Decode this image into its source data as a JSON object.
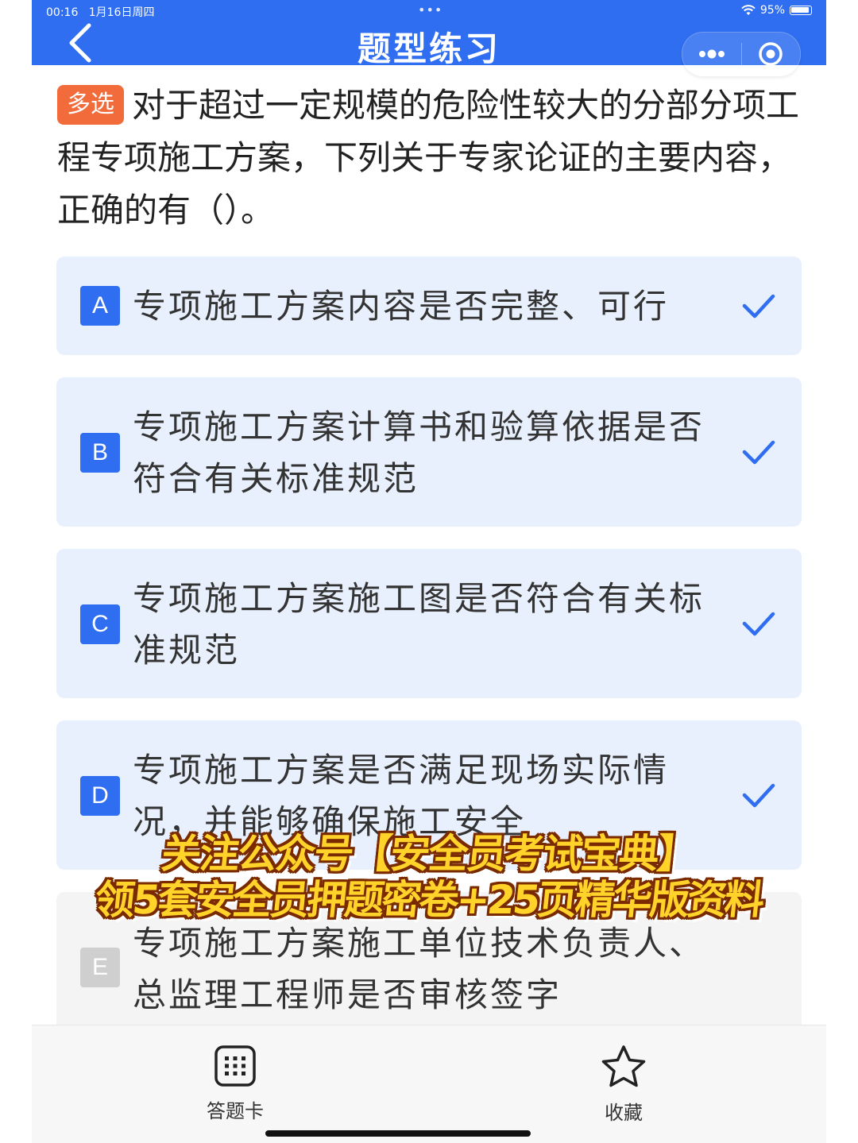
{
  "status": {
    "time": "00:16",
    "date": "1月16日周四",
    "battery": "95%",
    "dots": "•••"
  },
  "header": {
    "title": "题型练习"
  },
  "question": {
    "type_tag": "多选",
    "text": "对于超过一定规模的危险性较大的分部分项工程专项施工方案，下列关于专家论证的主要内容，正确的有（）。"
  },
  "options": [
    {
      "letter": "A",
      "text": "专项施工方案内容是否完整、可行",
      "selected": true
    },
    {
      "letter": "B",
      "text": "专项施工方案计算书和验算依据是否符合有关标准规范",
      "selected": true
    },
    {
      "letter": "C",
      "text": "专项施工方案施工图是否符合有关标准规范",
      "selected": true
    },
    {
      "letter": "D",
      "text": "专项施工方案是否满足现场实际情况，并能够确保施工安全",
      "selected": true
    },
    {
      "letter": "E",
      "text": "专项施工方案施工单位技术负责人、总监理工程师是否审核签字",
      "selected": false
    }
  ],
  "promo": {
    "line1": "关注公众号【安全员考试宝典】",
    "line2": "领5套安全员押题密卷+25页精华版资料"
  },
  "bottom_tabs": {
    "answer_card": "答题卡",
    "favorite": "收藏"
  },
  "colors": {
    "accent": "#2f6ef0",
    "tag": "#f26b3a",
    "option_bg": "#e9f0fd"
  }
}
